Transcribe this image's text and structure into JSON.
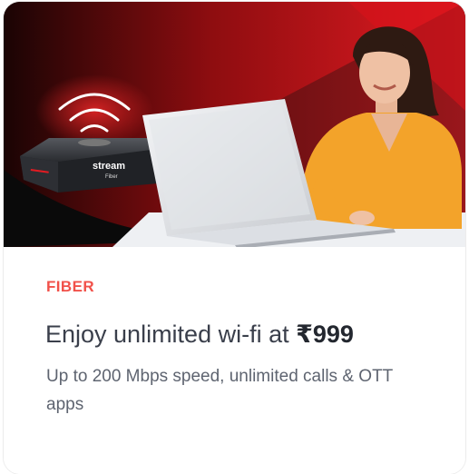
{
  "hero": {
    "device_brand": "stream",
    "device_sub": "Fiber",
    "colors": {
      "red": "#e0161d",
      "dark": "#111111",
      "shirt": "#f3a32a"
    }
  },
  "card": {
    "category": "FIBER",
    "headline_prefix": "Enjoy unlimited wi-fi at ",
    "headline_price": "₹999",
    "description": "Up to 200 Mbps speed, unlimited calls & OTT apps"
  }
}
